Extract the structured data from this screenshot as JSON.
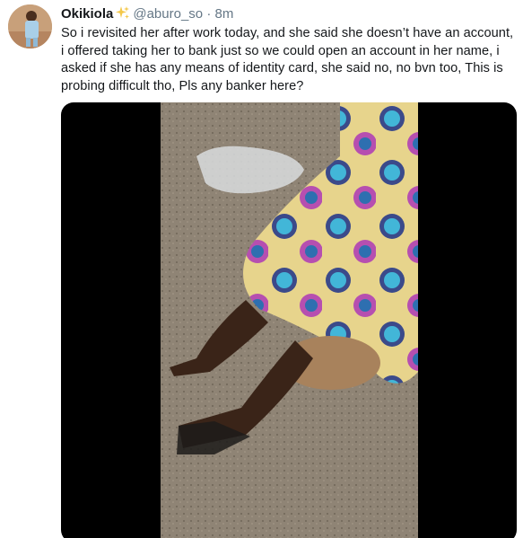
{
  "tweet": {
    "display_name": "Okikiola",
    "emoji": "sparkles",
    "handle": "@aburo_so",
    "separator": "·",
    "time": "8m",
    "text": "So i revisited her after work today, and she said she doesn’t have an account, i offered taking her to bank just so we could open an account in her name, i asked if she has any means of identity card, she said no, no bvn too, This is probing difficult tho, Pls any banker here?"
  },
  "media": {
    "type": "video",
    "description_icon": "video-frame"
  },
  "colors": {
    "text": "#14171a",
    "secondary": "#657786",
    "media_bg": "#000000",
    "sparkle": "#f4c84a"
  }
}
